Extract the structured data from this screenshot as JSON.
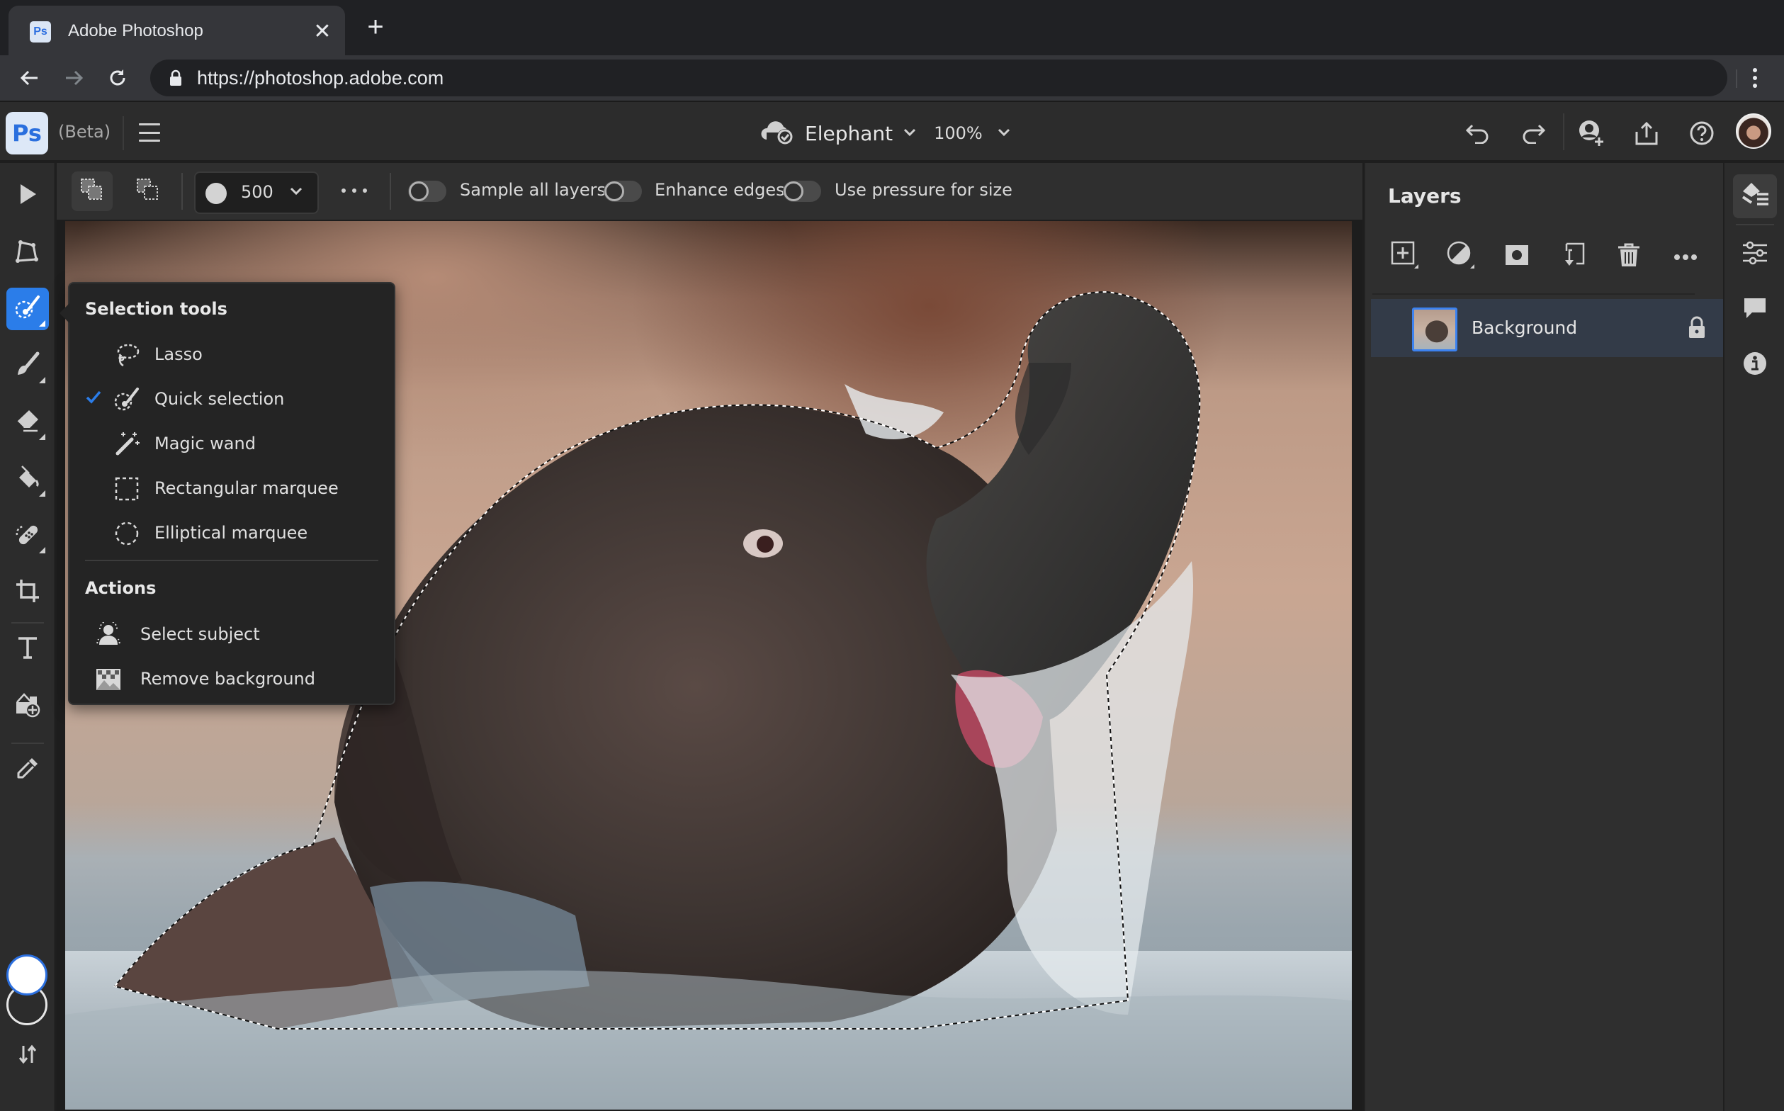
{
  "browser": {
    "tab_title": "Adobe Photoshop",
    "favicon_text": "Ps",
    "url": "https://photoshop.adobe.com",
    "icons": {
      "back": "arrow-left-icon",
      "forward": "arrow-right-icon",
      "reload": "reload-icon",
      "lock": "lock-icon",
      "close_tab": "close-icon",
      "new_tab": "plus-icon",
      "menu": "kebab-menu-icon"
    }
  },
  "app": {
    "logo_text": "Ps",
    "beta_label": "(Beta)",
    "document_name": "Elephant",
    "document_status_icon": "cloud-synced-icon",
    "zoom_level": "100%",
    "header_actions": [
      "undo",
      "redo",
      "invite",
      "share",
      "help",
      "profile"
    ],
    "accent_color": "#2b7de9"
  },
  "left_toolbar": {
    "tools": [
      {
        "id": "move",
        "icon": "move-arrow-icon"
      },
      {
        "id": "transform",
        "icon": "transform-icon"
      },
      {
        "id": "selection",
        "icon": "quick-selection-icon",
        "active": true
      },
      {
        "id": "brush",
        "icon": "brush-icon"
      },
      {
        "id": "eraser",
        "icon": "eraser-icon"
      },
      {
        "id": "fill",
        "icon": "paint-bucket-icon"
      },
      {
        "id": "healing",
        "icon": "healing-bandage-icon"
      },
      {
        "id": "crop",
        "icon": "crop-icon"
      },
      {
        "id": "type",
        "icon": "type-icon"
      },
      {
        "id": "add-image",
        "icon": "add-image-icon"
      },
      {
        "id": "eyedropper",
        "icon": "eyedropper-icon"
      }
    ],
    "foreground_color": "#ffffff",
    "background_color": "#2c2c2c",
    "swap_icon": "swap-colors-icon"
  },
  "options_bar": {
    "brush_size": "500",
    "toggles": [
      {
        "label": "Sample all layers",
        "on": false
      },
      {
        "label": "Enhance edges",
        "on": false
      },
      {
        "label": "Use pressure for size",
        "on": false
      }
    ]
  },
  "flyout": {
    "title": "Selection tools",
    "items": [
      {
        "label": "Lasso",
        "icon": "lasso-icon",
        "checked": false
      },
      {
        "label": "Quick selection",
        "icon": "quick-selection-icon",
        "checked": true
      },
      {
        "label": "Magic wand",
        "icon": "magic-wand-icon",
        "checked": false
      },
      {
        "label": "Rectangular marquee",
        "icon": "rectangular-marquee-icon",
        "checked": false
      },
      {
        "label": "Elliptical marquee",
        "icon": "elliptical-marquee-icon",
        "checked": false
      }
    ],
    "actions_title": "Actions",
    "actions": [
      {
        "label": "Select subject",
        "icon": "select-subject-icon"
      },
      {
        "label": "Remove background",
        "icon": "remove-background-icon"
      }
    ]
  },
  "layers_panel": {
    "title": "Layers",
    "toolbar": [
      "add-layer-icon",
      "adjustment-layer-icon",
      "layer-mask-icon",
      "clipping-mask-icon",
      "trash-icon",
      "more-icon"
    ],
    "layers": [
      {
        "name": "Background",
        "locked": true,
        "selected": true
      }
    ]
  },
  "right_rail": {
    "items": [
      "layers-panel-icon",
      "properties-icon",
      "comments-icon",
      "info-icon"
    ]
  },
  "canvas": {
    "subject": "Elephant splashing water",
    "has_selection": true
  }
}
